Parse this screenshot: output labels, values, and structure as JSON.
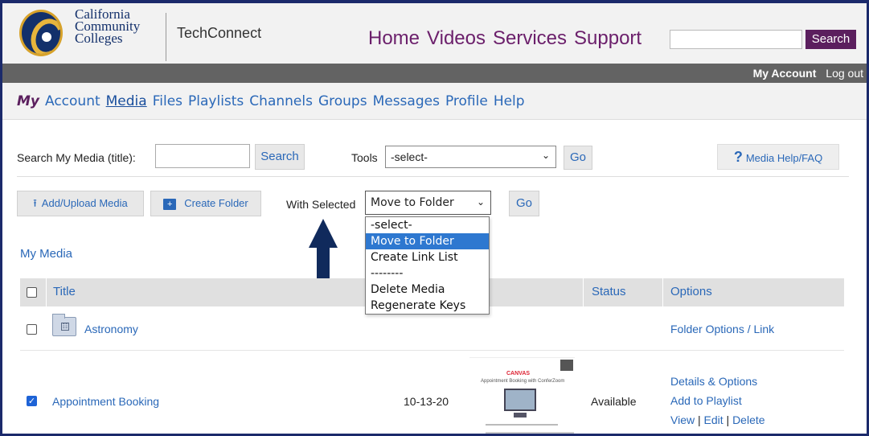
{
  "header": {
    "logo_lines": [
      "California",
      "Community",
      "Colleges"
    ],
    "brand": "TechConnect",
    "nav": [
      "Home",
      "Videos",
      "Services",
      "Support"
    ],
    "search_button": "Search",
    "search_placeholder": ""
  },
  "account_bar": {
    "my_account": "My Account",
    "logout": "Log out"
  },
  "my_nav": {
    "my": "My",
    "items": [
      "Account",
      "Media",
      "Files",
      "Playlists",
      "Channels",
      "Groups",
      "Messages",
      "Profile",
      "Help"
    ],
    "active": "Media"
  },
  "search_section": {
    "label": "Search My Media (title):",
    "input_value": "",
    "search_button": "Search",
    "tools_label": "Tools",
    "tools_selected": "-select-",
    "go_button": "Go",
    "help_button": "Media Help/FAQ"
  },
  "action_section": {
    "upload_button": "Add/Upload Media",
    "create_folder_button": "Create Folder",
    "with_selected_label": "With Selected",
    "with_selected_value": "Move to Folder",
    "go_button": "Go",
    "dropdown_options": [
      "-select-",
      "Move to Folder",
      "Create Link List",
      "--------",
      "Delete Media",
      "Regenerate Keys"
    ],
    "dropdown_selected_index": 1
  },
  "my_media_heading": "My Media",
  "table": {
    "columns": [
      "Title",
      "Status",
      "Options"
    ],
    "rows": [
      {
        "checked": false,
        "title": "Astronomy",
        "options": "Folder Options / Link"
      },
      {
        "checked": true,
        "title": "Appointment Booking",
        "date": "10-13-20",
        "status": "Available",
        "options": [
          "Details & Options",
          "Add to Playlist"
        ],
        "view": "View",
        "edit": "Edit",
        "delete": "Delete",
        "thumbnail_text": [
          "CANVAS",
          "Appointment Booking with ConferZoom"
        ]
      }
    ]
  },
  "colors": {
    "brand_purple": "#5b1f5e",
    "link_blue": "#2a68b8",
    "dropdown_highlight": "#2e78d0",
    "arrow": "#102a5c"
  }
}
